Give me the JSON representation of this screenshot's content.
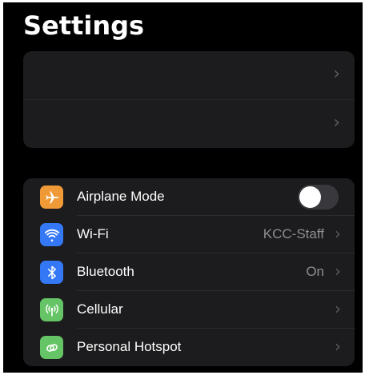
{
  "header": {
    "title": "Settings"
  },
  "account_group": {
    "rows": [
      {
        "chevron": "›"
      },
      {
        "chevron": "›"
      }
    ]
  },
  "settings": {
    "airplane_mode": {
      "label": "Airplane Mode",
      "icon": "airplane-icon",
      "icon_color": "#f09a37",
      "toggle_on": false
    },
    "wifi": {
      "label": "Wi-Fi",
      "value": "KCC-Staff",
      "icon": "wifi-icon",
      "icon_color": "#3478f6",
      "chevron": "›"
    },
    "bluetooth": {
      "label": "Bluetooth",
      "value": "On",
      "icon": "bluetooth-icon",
      "icon_color": "#3478f6",
      "chevron": "›"
    },
    "cellular": {
      "label": "Cellular",
      "icon": "cellular-antenna-icon",
      "icon_color": "#65c466",
      "chevron": "›"
    },
    "hotspot": {
      "label": "Personal Hotspot",
      "icon": "hotspot-chain-icon",
      "icon_color": "#65c466",
      "chevron": "›"
    }
  },
  "colors": {
    "background": "#000000",
    "group_background": "#1c1c1e",
    "secondary_text": "#8e8e93",
    "toggle_off": "#39393d"
  }
}
